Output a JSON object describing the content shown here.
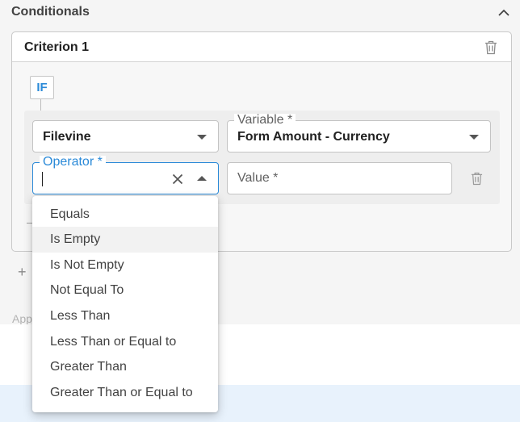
{
  "section": {
    "title": "Conditionals"
  },
  "criterion": {
    "title": "Criterion 1",
    "if_label": "IF",
    "source_value": "Filevine",
    "variable_label": "Variable *",
    "variable_value": "Form Amount - Currency",
    "operator_label": "Operator *",
    "operator_value": "",
    "value_placeholder": "Value *"
  },
  "footer": {
    "app_label": "App"
  },
  "operator_options": [
    "Equals",
    "Is Empty",
    "Is Not Empty",
    "Not Equal To",
    "Less Than",
    "Less Than or Equal to",
    "Greater Than",
    "Greater Than or Equal to"
  ],
  "highlighted_option": "Is Empty",
  "colors": {
    "accent": "#2b8ad8",
    "highlight": "#f2f2f2",
    "band": "#e8f2fc"
  },
  "icons": {
    "collapse": "chevron-up-icon",
    "delete": "trash-icon",
    "clear": "close-icon",
    "add": "plus-icon"
  }
}
